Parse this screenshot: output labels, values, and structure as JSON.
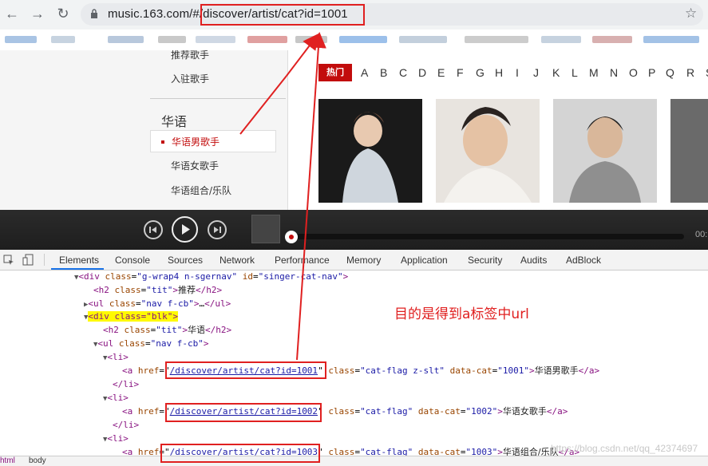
{
  "browser": {
    "url_host": "music.163.com/#",
    "url_path": "/discover/artist/cat?id=1001",
    "back_icon": "arrow-left-icon",
    "forward_icon": "arrow-right-icon",
    "reload_icon": "reload-icon",
    "star_icon": "star-icon"
  },
  "sidebar": {
    "top_item": "推荐歌手",
    "settled_item": "入驻歌手",
    "category_title": "华语",
    "items": [
      "华语男歌手",
      "华语女歌手",
      "华语组合/乐队"
    ]
  },
  "letters": {
    "hot_label": "热门",
    "list": [
      "A",
      "B",
      "C",
      "D",
      "E",
      "F",
      "G",
      "H",
      "I",
      "J",
      "K",
      "L",
      "M",
      "N",
      "O",
      "P",
      "Q",
      "R",
      "S"
    ]
  },
  "player": {
    "time": "00:"
  },
  "devtools": {
    "tabs": [
      "Elements",
      "Console",
      "Sources",
      "Network",
      "Performance",
      "Memory",
      "Application",
      "Security",
      "Audits",
      "AdBlock"
    ],
    "active_tab": "Elements",
    "breadcrumbs": [
      "html",
      "body"
    ],
    "lines": {
      "l1_tag": "div",
      "l1_attr1": "class",
      "l1_val1": "\"g-wrap4 n-sgernav\"",
      "l1_attr2": "id",
      "l1_val2": "\"singer-cat-nav\"",
      "l2_tag": "h2",
      "l2_attr": "class",
      "l2_val": "\"tit\"",
      "l2_text": "推荐",
      "l3_tag": "ul",
      "l3_attr": "class",
      "l3_val": "\"nav f-cb\"",
      "l3_text": "…",
      "l4_text": "<div class=\"blk\">",
      "l5_tag": "h2",
      "l5_attr": "class",
      "l5_val": "\"tit\"",
      "l5_text": "华语",
      "l6_tag": "ul",
      "l6_attr": "class",
      "l6_val": "\"nav f-cb\"",
      "li": "li",
      "a1_href": "/discover/artist/cat?id=1001",
      "a1_class": "\"cat-flag z-slt\"",
      "a1_data": "\"1001\"",
      "a1_text": "华语男歌手",
      "a2_href": "/discover/artist/cat?id=1002",
      "a2_class": "\"cat-flag\"",
      "a2_data": "\"1002\"",
      "a2_text": "华语女歌手",
      "a3_href": "/discover/artist/cat?id=1003",
      "a3_class": "\"cat-flag\"",
      "a3_data": "\"1003\"",
      "a3_text": "华语组合/乐队"
    }
  },
  "annotation": {
    "text": "目的是得到a标签中url"
  },
  "watermark": "https://blog.csdn.net/qq_42374697"
}
